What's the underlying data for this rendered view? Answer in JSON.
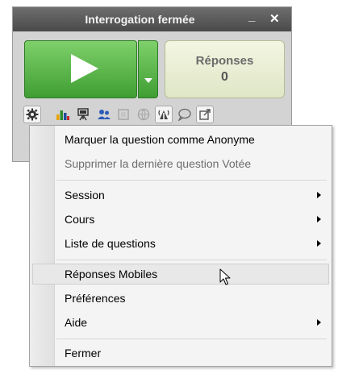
{
  "widget": {
    "title": "Interrogation fermée",
    "minimize_glyph": "_",
    "close_glyph": "✕",
    "play_icon": "play-icon",
    "responses_label": "Réponses",
    "responses_count": "0"
  },
  "toolbar": {
    "icons": [
      "gear-icon",
      "bar-chart-icon",
      "presenter-icon",
      "users-icon",
      "grid-icon",
      "globe-icon",
      "mobile-signal-icon",
      "speech-bubble-icon",
      "external-window-icon"
    ]
  },
  "menu": {
    "items": [
      {
        "label": "Marquer la question comme Anonyme"
      },
      {
        "label": "Supprimer la dernière question Votée"
      },
      {
        "label": "Session"
      },
      {
        "label": "Cours"
      },
      {
        "label": "Liste de questions"
      },
      {
        "label": "Réponses Mobiles"
      },
      {
        "label": "Préférences"
      },
      {
        "label": "Aide"
      },
      {
        "label": "Fermer"
      }
    ]
  },
  "colors": {
    "play_green_top": "#7fd06a",
    "play_green_bottom": "#3f9e33",
    "titlebar": "#4a4a4a",
    "menu_bg": "#f4f4f4"
  }
}
